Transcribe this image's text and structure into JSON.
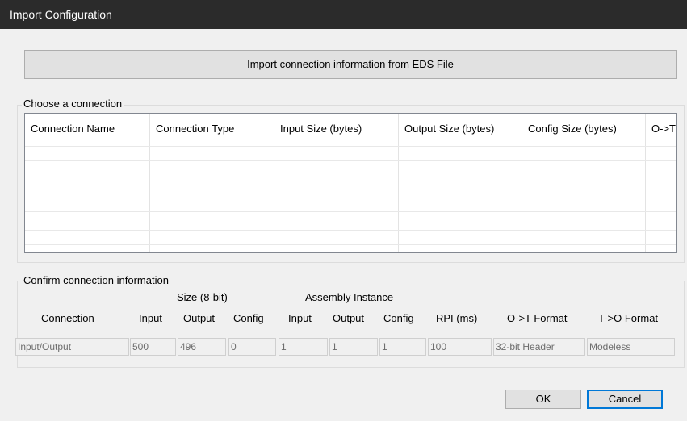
{
  "window": {
    "title": "Import Configuration"
  },
  "import_button": {
    "label": "Import connection information from EDS File"
  },
  "choose_group": {
    "label": "Choose a connection",
    "columns": [
      "Connection Name",
      "Connection Type",
      "Input Size (bytes)",
      "Output Size (bytes)",
      "Config Size (bytes)",
      "O->T"
    ]
  },
  "confirm_group": {
    "label": "Confirm connection information",
    "size_header": "Size (8-bit)",
    "assembly_header": "Assembly Instance",
    "columns": [
      "Connection",
      "Input",
      "Output",
      "Config",
      "Input",
      "Output",
      "Config",
      "RPI (ms)",
      "O->T Format",
      "T->O Format"
    ],
    "values": [
      "Input/Output",
      "500",
      "496",
      "0",
      "1",
      "1",
      "1",
      "100",
      "32-bit Header",
      "Modeless"
    ]
  },
  "buttons": {
    "ok": "OK",
    "cancel": "Cancel"
  }
}
